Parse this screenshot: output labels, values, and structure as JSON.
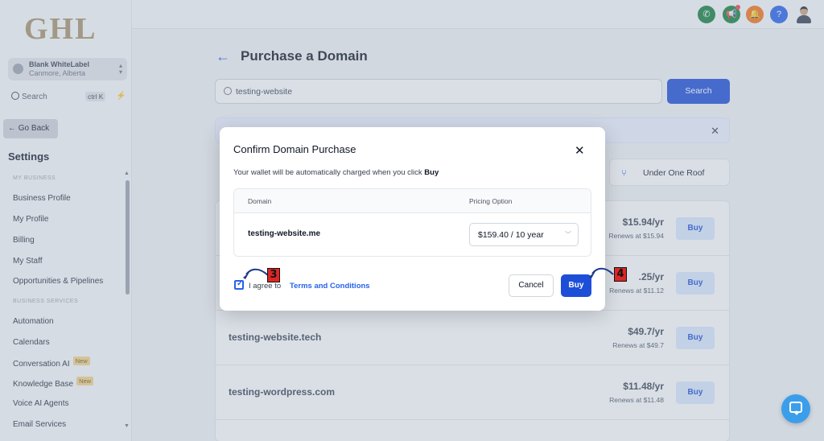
{
  "sidebar": {
    "logo": "GHL",
    "account": {
      "name": "Blank WhiteLabel",
      "location": "Canmore, Alberta"
    },
    "search": {
      "label": "Search",
      "shortcut": "ctrl K"
    },
    "go_back": "← Go Back",
    "settings_title": "Settings",
    "sections": {
      "my_business": "MY BUSINESS",
      "business_services": "BUSINESS SERVICES"
    },
    "items": [
      {
        "label": "Business Profile"
      },
      {
        "label": "My Profile"
      },
      {
        "label": "Billing"
      },
      {
        "label": "My Staff"
      },
      {
        "label": "Opportunities & Pipelines"
      },
      {
        "label": "Automation"
      },
      {
        "label": "Calendars"
      },
      {
        "label": "Conversation AI",
        "badge": "New"
      },
      {
        "label": "Knowledge Base",
        "badge": "New"
      },
      {
        "label": "Voice AI Agents"
      },
      {
        "label": "Email Services"
      }
    ]
  },
  "topbar": {
    "buttons": [
      {
        "icon": "phone-icon",
        "glyph": "✆",
        "color": "#15803d"
      },
      {
        "icon": "megaphone-icon",
        "glyph": "📢",
        "color": "#15803d"
      },
      {
        "icon": "bell-icon",
        "glyph": "🔔",
        "color": "#f97316"
      },
      {
        "icon": "help-icon",
        "glyph": "?",
        "color": "#2563eb"
      }
    ]
  },
  "page": {
    "title": "Purchase a Domain",
    "search_value": "testing-website",
    "search_button": "Search",
    "tab_label": "Under One Roof",
    "results": [
      {
        "name": "",
        "price": "$15.94/yr",
        "renew": "Renews at $15.94",
        "buy": "Buy"
      },
      {
        "name": "",
        "price": ".25/yr",
        "renew": "Renews at $11.12",
        "buy": "Buy"
      },
      {
        "name": "testing-website.tech",
        "price": "$49.7/yr",
        "renew": "Renews at $49.7",
        "buy": "Buy"
      },
      {
        "name": "testing-wordpress.com",
        "price": "$11.48/yr",
        "renew": "Renews at $11.48",
        "buy": "Buy"
      }
    ]
  },
  "modal": {
    "title": "Confirm Domain Purchase",
    "description_prefix": "Your wallet will be automatically charged when you click ",
    "description_bold": "Buy",
    "columns": {
      "domain": "Domain",
      "pricing": "Pricing Option"
    },
    "row": {
      "domain": "testing-website.me",
      "pricing": "$159.40 / 10 year"
    },
    "agree_prefix": "I agree to",
    "agree_link": "Terms and Conditions",
    "agree_checked": true,
    "cancel": "Cancel",
    "buy": "Buy"
  },
  "annotations": {
    "step_3": "3",
    "step_4": "4",
    "color": "#dc2626"
  }
}
